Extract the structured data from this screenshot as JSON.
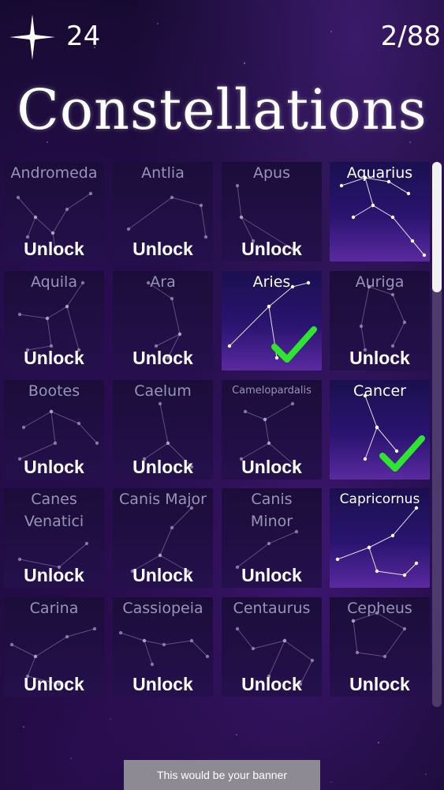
{
  "header": {
    "star_count": "24",
    "progress": "2/88",
    "title": "Constellations"
  },
  "unlock_label": "Unlock",
  "tiles": [
    {
      "name": "Andromeda",
      "unlocked": false
    },
    {
      "name": "Antlia",
      "unlocked": false
    },
    {
      "name": "Apus",
      "unlocked": false
    },
    {
      "name": "Aquarius",
      "unlocked": true,
      "checked": false
    },
    {
      "name": "Aquila",
      "unlocked": false
    },
    {
      "name": "Ara",
      "unlocked": false
    },
    {
      "name": "Aries",
      "unlocked": true,
      "checked": true
    },
    {
      "name": "Auriga",
      "unlocked": false
    },
    {
      "name": "Bootes",
      "unlocked": false
    },
    {
      "name": "Caelum",
      "unlocked": false
    },
    {
      "name": "Camelopardalis",
      "unlocked": false
    },
    {
      "name": "Cancer",
      "unlocked": true,
      "checked": true
    },
    {
      "name": "Canes Venatici",
      "unlocked": false
    },
    {
      "name": "Canis Major",
      "unlocked": false
    },
    {
      "name": "Canis Minor",
      "unlocked": false
    },
    {
      "name": "Capricornus",
      "unlocked": true,
      "checked": false
    },
    {
      "name": "Carina",
      "unlocked": false
    },
    {
      "name": "Cassiopeia",
      "unlocked": false
    },
    {
      "name": "Centaurus",
      "unlocked": false
    },
    {
      "name": "Cepheus",
      "unlocked": false
    }
  ],
  "banner": {
    "text": "This would be your banner"
  },
  "colors": {
    "check": "#2ee62e",
    "background": "#160a30",
    "banner": "#8d8a93"
  },
  "icons": {
    "star_count_icon": "four-point-star-icon",
    "complete_icon": "checkmark-icon"
  }
}
